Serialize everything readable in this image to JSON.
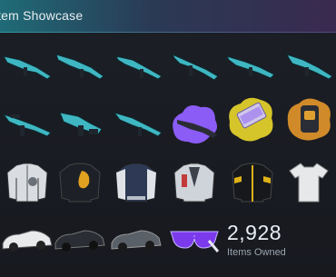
{
  "showcase": {
    "title": "Item Showcase",
    "items_owned_count": "2,928",
    "items_owned_label": "Items Owned"
  },
  "items": [
    {
      "name": "rifle-teal-icon"
    },
    {
      "name": "rifle-teal-icon"
    },
    {
      "name": "rifle-teal-icon"
    },
    {
      "name": "rifle-teal-icon"
    },
    {
      "name": "rifle-teal-icon"
    },
    {
      "name": "rifle-teal-icon"
    },
    {
      "name": "rifle-teal-icon"
    },
    {
      "name": "smg-teal-icon"
    },
    {
      "name": "rifle-teal-icon"
    },
    {
      "name": "rifle-purple-splash-icon"
    },
    {
      "name": "crate-yellow-splash-icon"
    },
    {
      "name": "backpack-orange-splash-icon"
    },
    {
      "name": "jacket-white-icon"
    },
    {
      "name": "jacket-black-gold-icon"
    },
    {
      "name": "jacket-varsity-icon"
    },
    {
      "name": "jacket-grey-icon"
    },
    {
      "name": "jacket-black-yellow-icon"
    },
    {
      "name": "tshirt-white-icon"
    },
    {
      "name": "car-white-icon"
    },
    {
      "name": "car-black-icon"
    },
    {
      "name": "car-grey-icon"
    },
    {
      "name": "sunglasses-purple-icon"
    }
  ],
  "colors": {
    "teal": "#3fb7c2",
    "purple": "#8b5cf6",
    "yellow": "#d6c52a",
    "orange": "#d08a2a"
  }
}
